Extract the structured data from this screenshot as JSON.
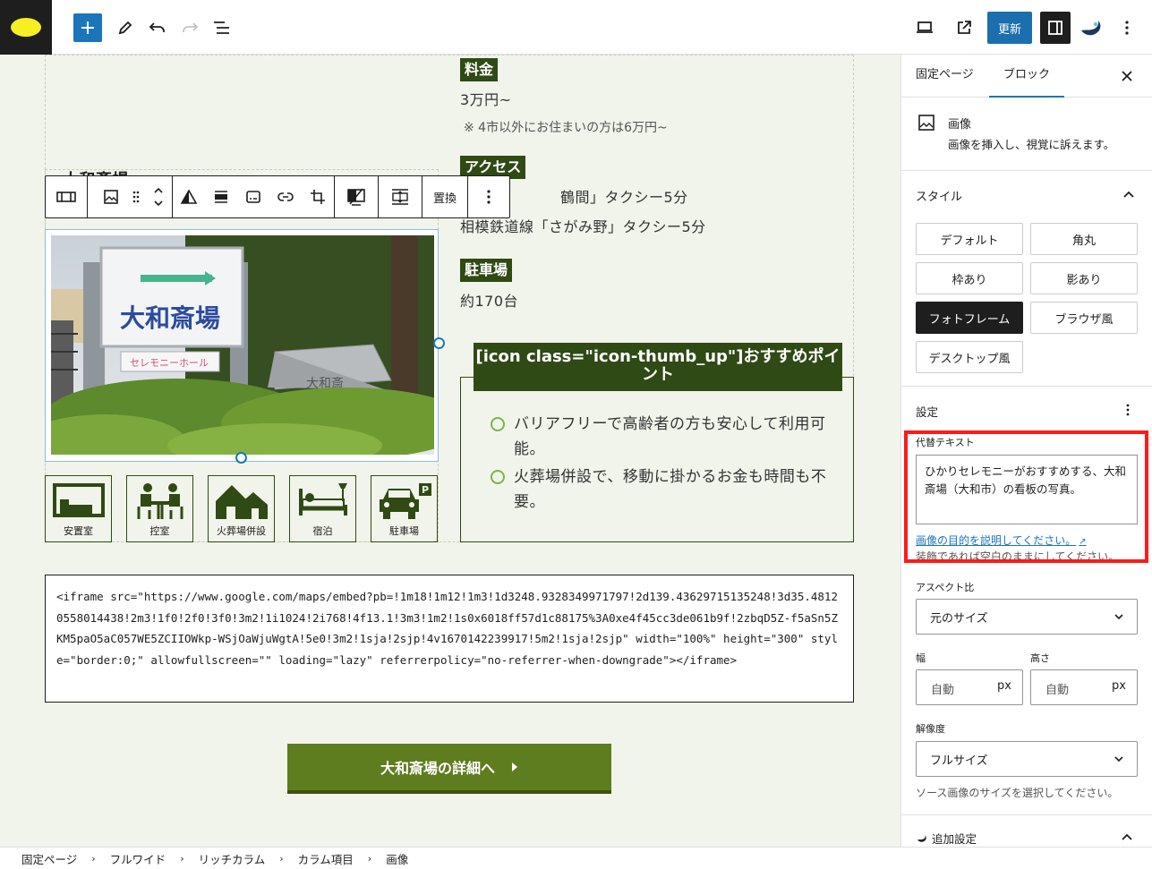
{
  "toolbar": {
    "update_label": "更新"
  },
  "content": {
    "price_label": "料金",
    "price_value": "3万円~",
    "price_note": "※ 4市以外にお住まいの方は6万円~",
    "access_label": "アクセス",
    "access_line1": "鶴間」タクシー5分",
    "access_line2": "相模鉄道線「さがみ野」タクシー5分",
    "parking_label": "駐車場",
    "parking_value": "約170台",
    "hidden_heading": "大和斎場",
    "replace_label": "置換",
    "photo_sign_main": "大和斎場",
    "photo_sign_sub": "セレモニーホール",
    "photo_stone_text": "大和斎",
    "facilities": [
      {
        "label": "安置室",
        "icon": "bed-room-icon"
      },
      {
        "label": "控室",
        "icon": "waiting-room-icon"
      },
      {
        "label": "火葬場併設",
        "icon": "crematorium-icon"
      },
      {
        "label": "宿泊",
        "icon": "lodging-icon"
      },
      {
        "label": "駐車場",
        "icon": "parking-icon"
      }
    ],
    "recommend_title": "[icon class=\"icon-thumb_up\"]おすすめポイント",
    "recommend_items": [
      "バリアフリーで高齢者の方も安心して利用可能。",
      "火葬場併設で、移動に掛かるお金も時間も不要。"
    ],
    "code_text": "<iframe src=\"https://www.google.com/maps/embed?pb=!1m18!1m12!1m3!1d3248.9328349971797!2d139.43629715135248!3d35.48120558014438!2m3!1f0!2f0!3f0!3m2!1i1024!2i768!4f13.1!3m3!1m2!1s0x6018ff57d1c88175%3A0xe4f45cc3de061b9f!2zbqD5Z-f5aSn5ZKM5paO5aC057WE5ZCIIOWkp-WSjOaWjuWgtA!5e0!3m2!1sja!2sjp!4v1670142239917!5m2!1sja!2sjp\" width=\"100%\" height=\"300\" style=\"border:0;\" allowfullscreen=\"\" loading=\"lazy\" referrerpolicy=\"no-referrer-when-downgrade\"></iframe>",
    "cta_label": "大和斎場の詳細へ"
  },
  "sidebar": {
    "tab_page": "固定ページ",
    "tab_block": "ブロック",
    "block_name": "画像",
    "block_desc": "画像を挿入し、視覚に訴えます。",
    "style_heading": "スタイル",
    "styles": [
      "デフォルト",
      "角丸",
      "枠あり",
      "影あり",
      "フォトフレーム",
      "ブラウザ風",
      "デスクトップ風"
    ],
    "active_style": "フォトフレーム",
    "settings_heading": "設定",
    "alt_label": "代替テキスト",
    "alt_value": "ひかりセレモニーがおすすめする、大和斎場（大和市）の看板の写真。",
    "alt_help_link": "画像の目的を説明してください。",
    "alt_help_text": "装飾であれば空白のままにしてください。",
    "aspect_label": "アスペクト比",
    "aspect_value": "元のサイズ",
    "width_label": "幅",
    "height_label": "高さ",
    "width_value": "自動",
    "height_value": "自動",
    "unit": "px",
    "resolution_label": "解像度",
    "resolution_value": "フルサイズ",
    "resolution_help": "ソース画像のサイズを選択してください。",
    "advanced_label": "追加設定"
  },
  "breadcrumb": [
    "固定ページ",
    "フルワイド",
    "リッチカラム",
    "カラム項目",
    "画像"
  ],
  "colors": {
    "accent": "#1b75bb",
    "brand_green": "#2f4a14",
    "cta_green": "#5e7d1e",
    "highlight_red": "#ff1a1a"
  }
}
